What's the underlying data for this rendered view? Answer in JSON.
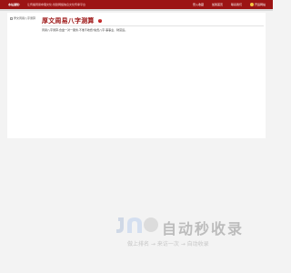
{
  "topbar": {
    "notice_label": "本站通知:",
    "notice_text": "让传播周易命理文化,创建网络信息文化传承平台",
    "nav": [
      "登入收藏",
      "加我首页",
      "联系我们"
    ],
    "nav_right": "开运网站"
  },
  "header": {
    "logo_text": "厚文周易八字测算",
    "title": "厚文周易八字测算",
    "badge": "!",
    "description": "周易八字测算,合盘一对一服务,不准不收费!免费八字,事事业、财富运。"
  },
  "watermark": {
    "brand": "自动秒收录",
    "slogan": "做上排名 → 来访一次 → 自动收录"
  },
  "colors": {
    "brand_red": "#9c1414",
    "watermark_gray": "#bcbcbc"
  }
}
